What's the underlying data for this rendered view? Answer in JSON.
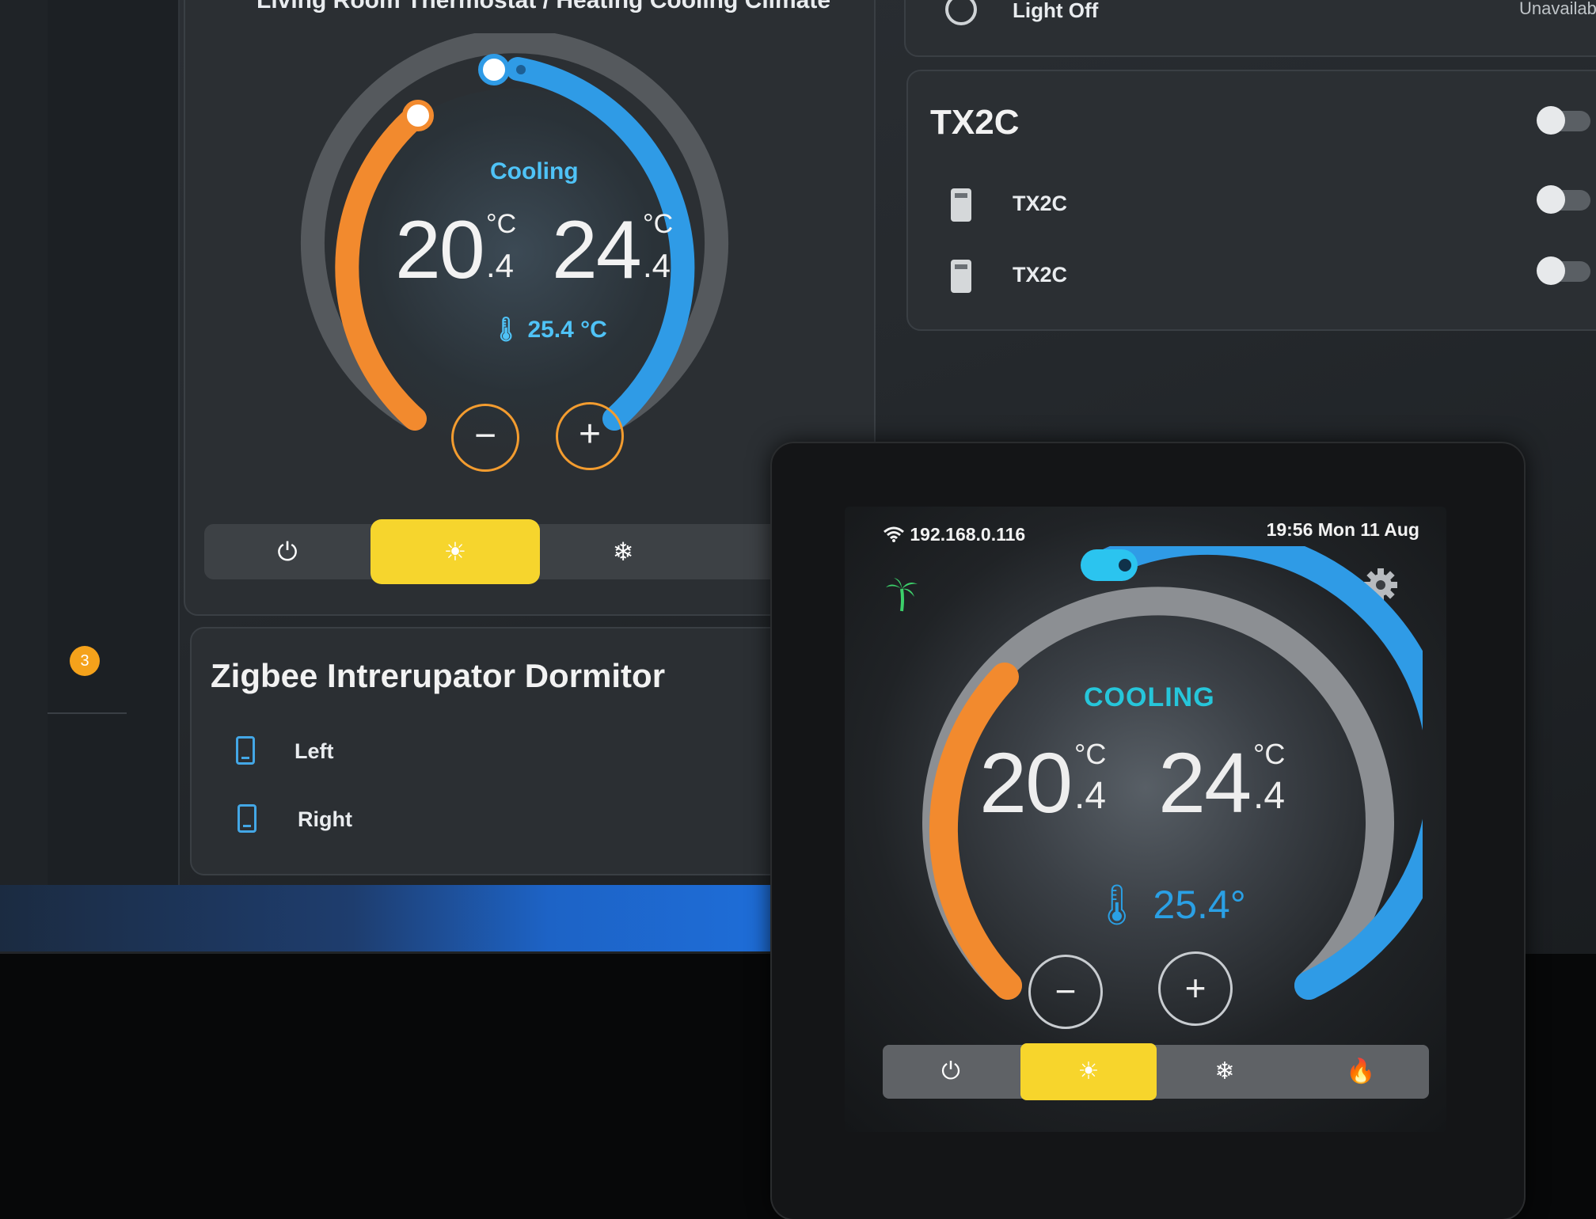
{
  "dashboard": {
    "thermostat": {
      "title": "Living Room Thermostat / Heating Cooling Climate",
      "state": "Cooling",
      "low_int": "20",
      "low_dec": ".4",
      "high_int": "24",
      "high_dec": ".4",
      "unit": "°C",
      "current": "25.4 °C",
      "minus": "−",
      "plus": "+",
      "modes": [
        "⏻",
        "☀",
        "❄"
      ]
    },
    "zigbee": {
      "title": "Zigbee Intrerupator Dormitor",
      "rows": [
        "Left",
        "Right"
      ]
    },
    "light": {
      "label": "Light Off",
      "status": "Unavailable"
    },
    "tx2c": {
      "title": "TX2C",
      "rows": [
        "TX2C",
        "TX2C"
      ]
    },
    "badge": "3"
  },
  "device": {
    "ip": "192.168.0.116",
    "datetime": "19:56 Mon 11 Aug",
    "state": "COOLING",
    "low_int": "20",
    "low_dec": ".4",
    "high_int": "24",
    "high_dec": ".4",
    "unit": "°C",
    "current": "25.4°",
    "minus": "−",
    "plus": "+",
    "modes": [
      "⏻",
      "☀",
      "❄",
      "🔥"
    ]
  },
  "colors": {
    "heat": "#f28a2e",
    "cool": "#2f9be6",
    "active_mode": "#f6d52d",
    "state_text": "#4fc3f7"
  }
}
